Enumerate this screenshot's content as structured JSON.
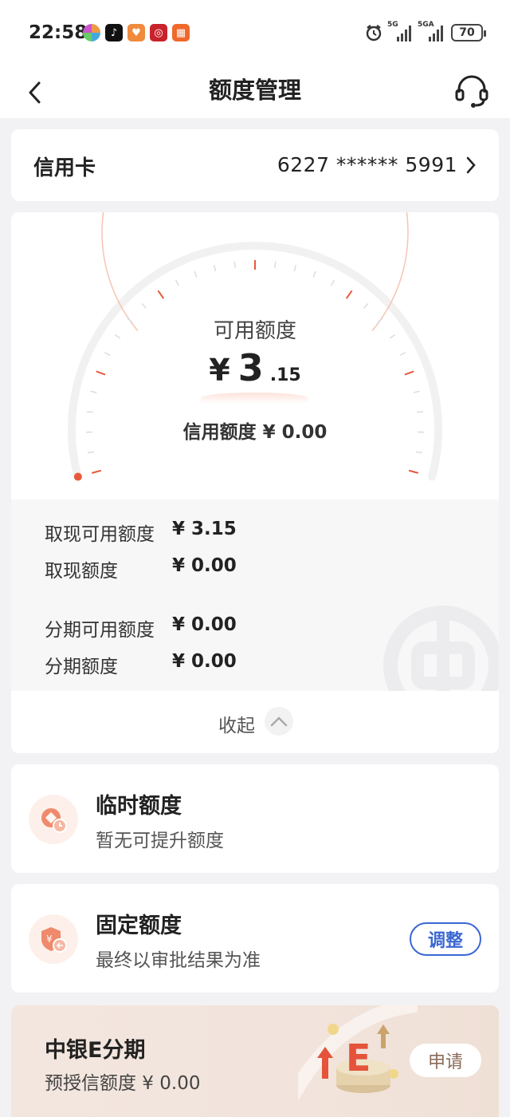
{
  "status": {
    "time": "22:58",
    "network1": "5G",
    "network2": "5GA",
    "battery": "70"
  },
  "nav": {
    "title": "额度管理"
  },
  "card": {
    "label": "信用卡",
    "number": "6227 ****** 5991"
  },
  "limit": {
    "available_title": "可用额度",
    "currency": "¥",
    "available_int": "3",
    "available_dec": ".15",
    "credit_line": "信用额度 ¥ 0.00",
    "gauge_fraction": 0.0
  },
  "details": [
    {
      "label": "取现可用额度",
      "value": "¥ 3.15"
    },
    {
      "label": "取现额度",
      "value": "¥ 0.00"
    },
    {
      "label": "分期可用额度",
      "value": "¥ 0.00"
    },
    {
      "label": "分期额度",
      "value": "¥ 0.00"
    }
  ],
  "collapse_label": "收起",
  "temp_limit": {
    "title": "临时额度",
    "subtitle": "暂无可提升额度"
  },
  "fixed_limit": {
    "title": "固定额度",
    "subtitle": "最终以审批结果为准",
    "button": "调整"
  },
  "promo": {
    "title": "中银E分期",
    "subtitle": "预授信额度 ¥ 0.00",
    "button": "申请"
  },
  "colors": {
    "accent": "#e8583a",
    "primary_blue": "#3a67d2"
  }
}
